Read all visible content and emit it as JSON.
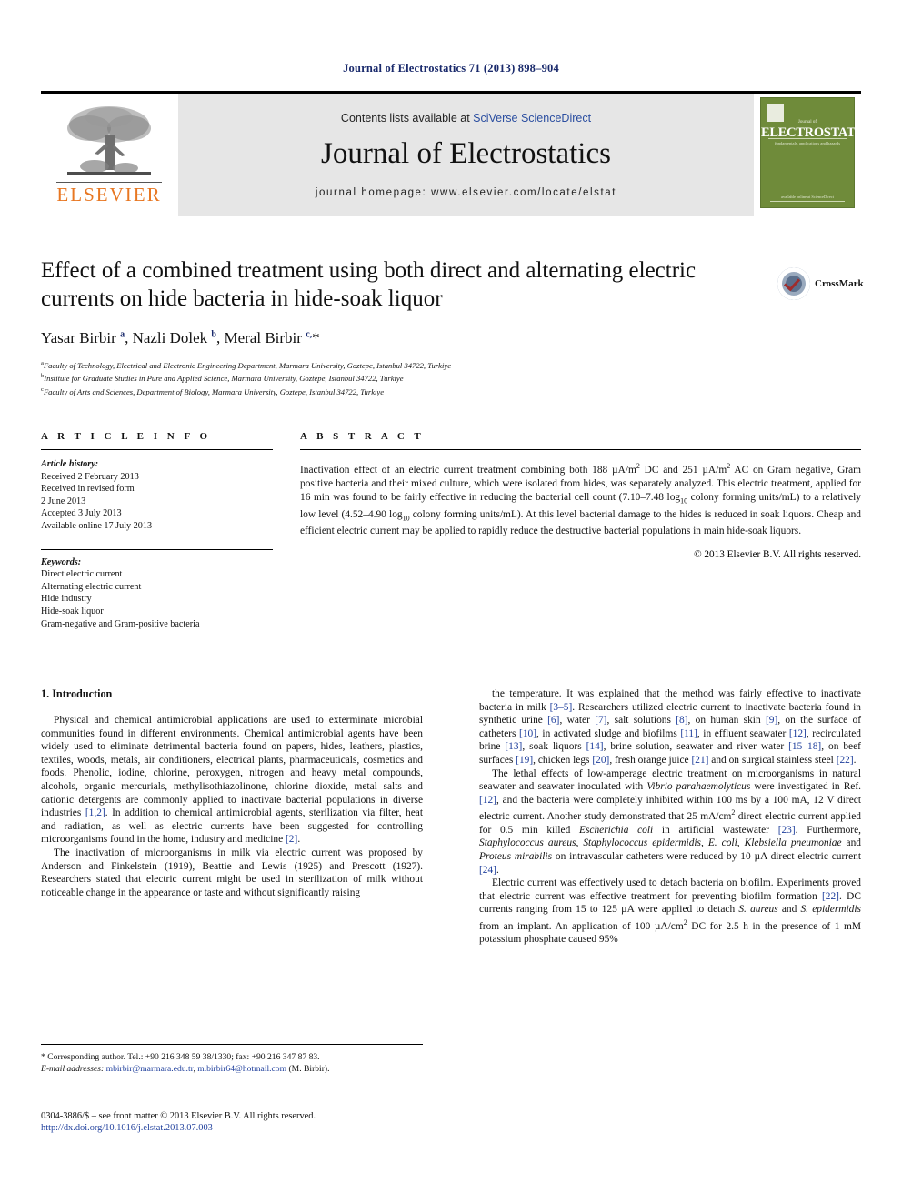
{
  "running_head": "Journal of Electrostatics 71 (2013) 898–904",
  "masthead": {
    "publisher_wordmark": "ELSEVIER",
    "contents_prefix": "Contents lists available at ",
    "contents_link": "SciVerse ScienceDirect",
    "journal_name": "Journal of Electrostatics",
    "homepage": "journal homepage: www.elsevier.com/locate/elstat",
    "cover": {
      "small_top": "Journal of",
      "title": "ELECTROSTATICS",
      "subtitle": "fundamentals, applications and hazards",
      "footer": "available online at\nScienceDirect"
    }
  },
  "article": {
    "title": "Effect of a combined treatment using both direct and alternating electric currents on hide bacteria in hide-soak liquor",
    "authors_html": "Yasar Birbir <sup>a</sup>, Nazli Dolek <sup>b</sup>, Meral Birbir <sup>c,</sup><span class=\"star\">*</span>",
    "affiliations": [
      {
        "mark": "a",
        "text": "Faculty of Technology, Electrical and Electronic Engineering Department, Marmara University, Goztepe, Istanbul 34722, Turkiye"
      },
      {
        "mark": "b",
        "text": "Institute for Graduate Studies in Pure and Applied Science, Marmara University, Goztepe, Istanbul 34722, Turkiye"
      },
      {
        "mark": "c",
        "text": "Faculty of Arts and Sciences, Department of Biology, Marmara University, Goztepe, Istanbul 34722, Turkiye"
      }
    ],
    "crossmark_label": "CrossMark"
  },
  "article_info": {
    "heading": "A R T I C L E  I N F O",
    "history_label": "Article history:",
    "history": [
      "Received 2 February 2013",
      "Received in revised form",
      "2 June 2013",
      "Accepted 3 July 2013",
      "Available online 17 July 2013"
    ],
    "keywords_label": "Keywords:",
    "keywords": [
      "Direct electric current",
      "Alternating electric current",
      "Hide industry",
      "Hide-soak liquor",
      "Gram-negative and Gram-positive bacteria"
    ]
  },
  "abstract": {
    "heading": "A B S T R A C T",
    "text_html": "Inactivation effect of an electric current treatment combining both 188 &micro;A/m<sup class=\"x\">2</sup> DC and 251 &micro;A/m<sup class=\"x\">2</sup> AC on Gram negative, Gram positive bacteria and their mixed culture, which were isolated from hides, was separately analyzed. This electric treatment, applied for 16 min was found to be fairly effective in reducing the bacterial cell count (7.10&ndash;7.48 log<sub class=\"x\">10</sub> colony forming units/mL) to a relatively low level (4.52&ndash;4.90 log<sub class=\"x\">10</sub> colony forming units/mL). At this level bacterial damage to the hides is reduced in soak liquors. Cheap and efficient electric current may be applied to rapidly reduce the destructive bacterial populations in main hide-soak liquors.",
    "rights": "© 2013 Elsevier B.V. All rights reserved."
  },
  "body": {
    "section_heading": "1. Introduction",
    "left_paragraphs_html": [
      "Physical and chemical antimicrobial applications are used to exterminate microbial communities found in different environments. Chemical antimicrobial agents have been widely used to eliminate detrimental bacteria found on papers, hides, leathers, plastics, textiles, woods, metals, air conditioners, electrical plants, pharmaceuticals, cosmetics and foods. Phenolic, iodine, chlorine, peroxygen, nitrogen and heavy metal compounds, alcohols, organic mercurials, methylisothiazolinone, chlorine dioxide, metal salts and cationic detergents are commonly applied to inactivate bacterial populations in diverse industries <span class=\"ref\">[1,2]</span>. In addition to chemical antimicrobial agents, sterilization via filter, heat and radiation, as well as electric currents have been suggested for controlling microorganisms found in the home, industry and medicine <span class=\"ref\">[2]</span>.",
      "The inactivation of microorganisms in milk via electric current was proposed by Anderson and Finkelstein (1919), Beattie and Lewis (1925) and Prescott (1927). Researchers stated that electric current might be used in sterilization of milk without noticeable change in the appearance or taste and without significantly raising"
    ],
    "right_paragraphs_html": [
      "the temperature. It was explained that the method was fairly effective to inactivate bacteria in milk <span class=\"ref\">[3&ndash;5]</span>. Researchers utilized electric current to inactivate bacteria found in synthetic urine <span class=\"ref\">[6]</span>, water <span class=\"ref\">[7]</span>, salt solutions <span class=\"ref\">[8]</span>, on human skin <span class=\"ref\">[9]</span>, on the surface of catheters <span class=\"ref\">[10]</span>, in activated sludge and biofilms <span class=\"ref\">[11]</span>, in effluent seawater <span class=\"ref\">[12]</span>, recirculated brine <span class=\"ref\">[13]</span>, soak liquors <span class=\"ref\">[14]</span>, brine solution, seawater and river water <span class=\"ref\">[15&ndash;18]</span>, on beef surfaces <span class=\"ref\">[19]</span>, chicken legs <span class=\"ref\">[20]</span>, fresh orange juice <span class=\"ref\">[21]</span> and on surgical stainless steel <span class=\"ref\">[22]</span>.",
      "The lethal effects of low-amperage electric treatment on microorganisms in natural seawater and seawater inoculated with <span class=\"it\">Vibrio parahaemolyticus</span> were investigated in Ref. <span class=\"ref\">[12]</span>, and the bacteria were completely inhibited within 100 ms by a 100 mA, 12 V direct electric current. Another study demonstrated that 25 mA/cm<sup class=\"x\">2</sup> direct electric current applied for 0.5 min killed <span class=\"it\">Escherichia coli</span> in artificial wastewater <span class=\"ref\">[23]</span>. Furthermore, <span class=\"it\">Staphylococcus aureus, Staphylococcus epidermidis, E. coli, Klebsiella pneumoniae</span> and <span class=\"it\">Proteus mirabilis</span> on intravascular catheters were reduced by 10 &micro;A direct electric current <span class=\"ref\">[24]</span>.",
      "Electric current was effectively used to detach bacteria on biofilm. Experiments proved that electric current was effective treatment for preventing biofilm formation <span class=\"ref\">[22]</span>. DC currents ranging from 15 to 125 &micro;A were applied to detach <span class=\"it\">S. aureus</span> and <span class=\"it\">S. epidermidis</span> from an implant. An application of 100 &micro;A/cm<sup class=\"x\">2</sup> DC for 2.5 h in the presence of 1 mM potassium phosphate caused 95%"
    ]
  },
  "footnote": {
    "corresponding_html": "* Corresponding author. Tel.: +90 216 348 59 38/1330; fax: +90 216 347 87 83.",
    "email_html": "<span class=\"em\">E-mail addresses:</span> <span class=\"mail\">mbirbir@marmara.edu.tr</span>, <span class=\"mail\">m.birbir64@hotmail.com</span> (M. Birbir)."
  },
  "footer": {
    "issn_line": "0304-3886/$ – see front matter © 2013 Elsevier B.V. All rights reserved.",
    "doi": "http://dx.doi.org/10.1016/j.elstat.2013.07.003"
  }
}
